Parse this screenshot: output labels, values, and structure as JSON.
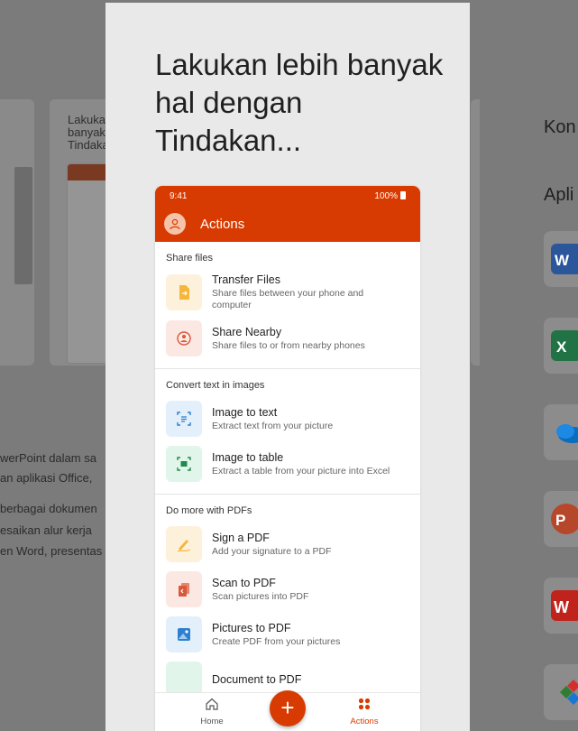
{
  "background": {
    "left_card_text": "",
    "middle_card_text": "Lakukan\nbanyak\nTindakan",
    "left_text_lines": [
      "werPoint dalam sa",
      "an aplikasi Office,",
      "berbagai dokumen",
      "esaikan alur kerja",
      "en Word, presentas"
    ],
    "right_labels": [
      "Kon",
      "Apli"
    ]
  },
  "dialog": {
    "headline": "Lakukan lebih banyak hal dengan Tindakan..."
  },
  "phone": {
    "status_time": "9:41",
    "status_battery": "100%",
    "appbar_title": "Actions",
    "sections": [
      {
        "title": "Share files",
        "items": [
          {
            "label": "Transfer Files",
            "desc": "Share files between your phone and computer"
          },
          {
            "label": "Share Nearby",
            "desc": "Share files to or from nearby phones"
          }
        ]
      },
      {
        "title": "Convert text in images",
        "items": [
          {
            "label": "Image to text",
            "desc": "Extract text from your picture"
          },
          {
            "label": "Image to table",
            "desc": "Extract a table from your picture into Excel"
          }
        ]
      },
      {
        "title": "Do more with PDFs",
        "items": [
          {
            "label": "Sign a PDF",
            "desc": "Add your signature to a PDF"
          },
          {
            "label": "Scan to PDF",
            "desc": "Scan pictures into PDF"
          },
          {
            "label": "Pictures to PDF",
            "desc": "Create PDF from your pictures"
          },
          {
            "label": "Document to PDF",
            "desc": ""
          }
        ]
      }
    ],
    "nav": {
      "home_label": "Home",
      "fab_label": "+",
      "actions_label": "Actions"
    }
  },
  "colors": {
    "accent": "#d83b01",
    "word": "#2b579a",
    "excel": "#217346",
    "onedrive": "#0a6ebd",
    "powerpoint": "#b7472a",
    "wps": "#c0231c"
  }
}
